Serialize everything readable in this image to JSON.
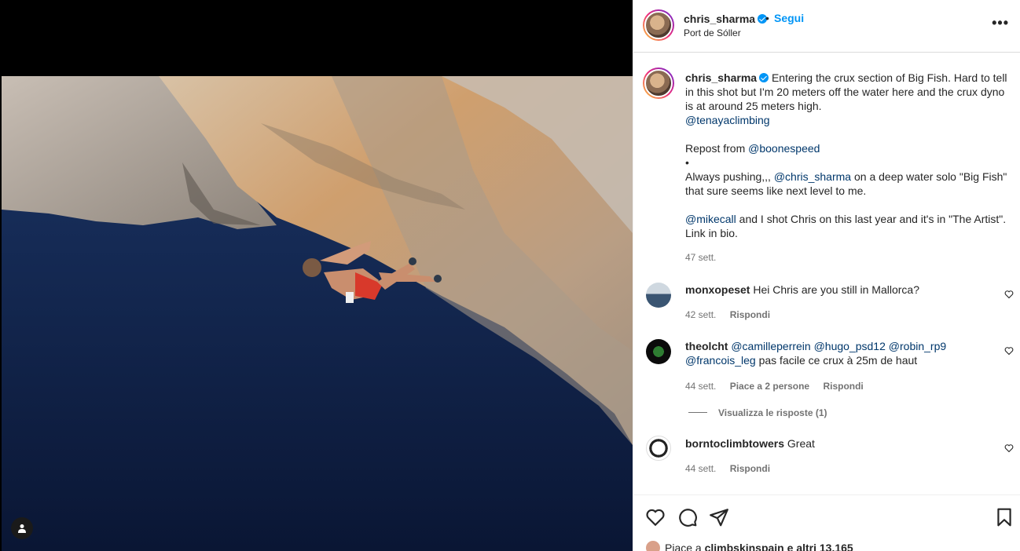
{
  "post": {
    "username": "chris_sharma",
    "dot": "•",
    "follow_label": "Segui",
    "location": "Port de Sóller",
    "more_label": "•••"
  },
  "caption": {
    "username": "chris_sharma",
    "text1": "Entering the crux section of Big Fish. Hard to tell in this shot but I'm 20 meters off the water here and the crux dyno is at around 25 meters high.",
    "mention1": "@tenayaclimbing",
    "repost_prefix": "Repost from ",
    "mention2": "@boonespeed",
    "bullet": "•",
    "text2a": "Always pushing,,, ",
    "mention3": "@chris_sharma",
    "text2b": " on a deep water solo \"Big Fish\" that sure seems like next level to me.",
    "mention4": "@mikecall",
    "text3": " and I shot Chris on this last year and it's in \"The Artist\". Link in bio.",
    "time": "47 sett."
  },
  "comments": [
    {
      "username": "monxopeset",
      "text": "Hei Chris are you still in Mallorca?",
      "time": "42 sett.",
      "reply": "Rispondi"
    },
    {
      "username": "theolcht",
      "m1": "@camilleperrein",
      "m2": "@hugo_psd12",
      "m3": "@robin_rp9",
      "m4": "@francois_leg",
      "text": " pas facile ce crux à 25m de haut",
      "time": "44 sett.",
      "likes": "Piace a 2 persone",
      "reply": "Rispondi",
      "view_replies": "Visualizza le risposte (1)"
    },
    {
      "username": "borntoclimbtowers",
      "text": "Great",
      "time": "44 sett.",
      "reply": "Rispondi"
    }
  ],
  "likes": {
    "prefix": "Piace a ",
    "user": "climbskinspain",
    "suffix": " e altri 13.165"
  },
  "colors": {
    "link": "#0095f6",
    "mention": "#00376b",
    "muted": "#737373",
    "sea": "#0f2248",
    "rock": "#c9a27a"
  },
  "icons": [
    "verified-badge-icon",
    "more-options-icon",
    "heart-icon",
    "comment-icon",
    "share-icon",
    "bookmark-icon",
    "user-tag-icon"
  ]
}
